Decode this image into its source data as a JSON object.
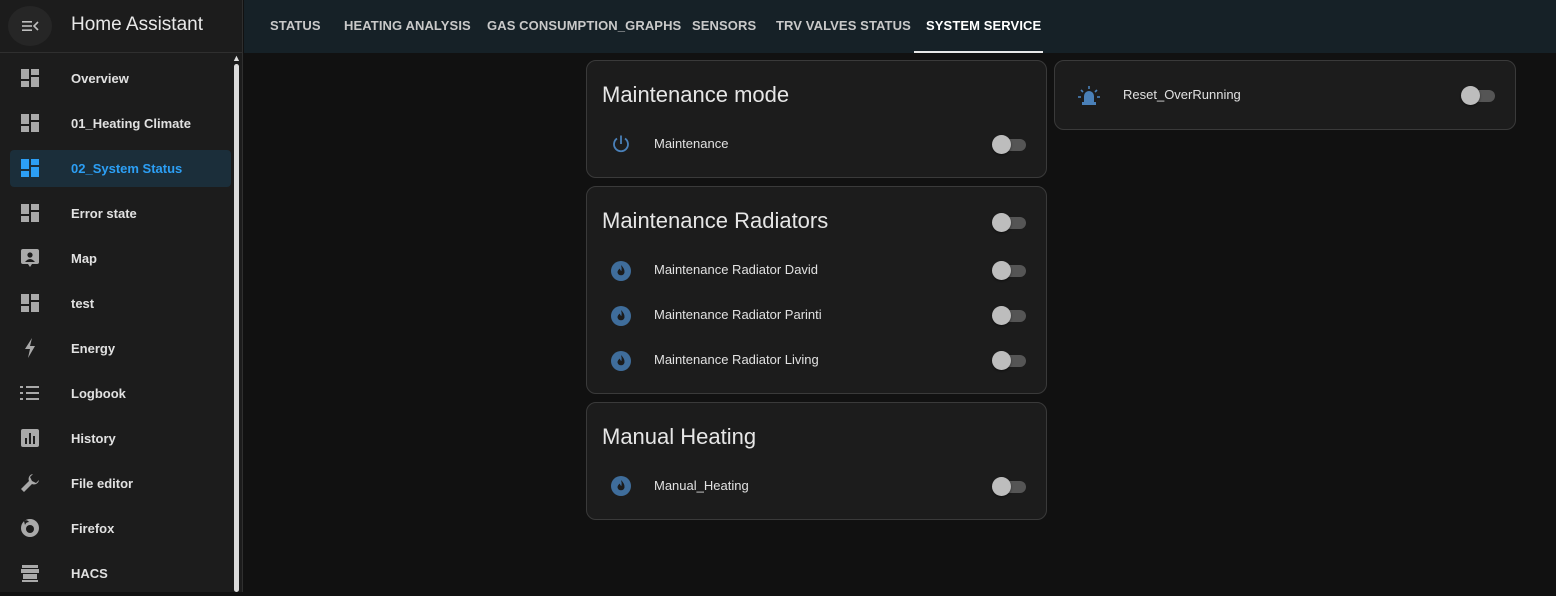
{
  "app": {
    "title": "Home Assistant"
  },
  "sidebar": {
    "items": [
      {
        "label": "Overview",
        "icon": "dashboard-icon"
      },
      {
        "label": "01_Heating Climate",
        "icon": "dashboard-icon"
      },
      {
        "label": "02_System Status",
        "icon": "dashboard-icon",
        "active": true
      },
      {
        "label": "Error state",
        "icon": "dashboard-icon"
      },
      {
        "label": "Map",
        "icon": "map-pin-icon"
      },
      {
        "label": "test",
        "icon": "dashboard-icon"
      },
      {
        "label": "Energy",
        "icon": "lightning-icon"
      },
      {
        "label": "Logbook",
        "icon": "list-icon"
      },
      {
        "label": "History",
        "icon": "chart-icon"
      },
      {
        "label": "File editor",
        "icon": "wrench-icon"
      },
      {
        "label": "Firefox",
        "icon": "firefox-icon"
      },
      {
        "label": "HACS",
        "icon": "hacs-icon"
      }
    ]
  },
  "tabs": [
    {
      "label": "STATUS"
    },
    {
      "label": "HEATING ANALYSIS"
    },
    {
      "label": "GAS CONSUMPTION_GRAPHS"
    },
    {
      "label": "SENSORS"
    },
    {
      "label": "TRV VALVES STATUS"
    },
    {
      "label": "SYSTEM SERVICE",
      "active": true
    }
  ],
  "cards": {
    "maintenance_mode": {
      "title": "Maintenance mode",
      "rows": [
        {
          "label": "Maintenance",
          "icon": "power-icon",
          "on": false
        }
      ]
    },
    "maintenance_radiators": {
      "title": "Maintenance Radiators",
      "header_toggle_on": false,
      "rows": [
        {
          "label": "Maintenance Radiator David",
          "icon": "fire-circle-icon",
          "on": false
        },
        {
          "label": "Maintenance Radiator Parinti",
          "icon": "fire-circle-icon",
          "on": false
        },
        {
          "label": "Maintenance Radiator Living",
          "icon": "fire-circle-icon",
          "on": false
        }
      ]
    },
    "manual_heating": {
      "title": "Manual Heating",
      "rows": [
        {
          "label": "Manual_Heating",
          "icon": "fire-circle-icon",
          "on": false
        }
      ]
    },
    "reset": {
      "rows": [
        {
          "label": "Reset_OverRunning",
          "icon": "alarm-light-icon",
          "on": false
        }
      ]
    }
  },
  "colors": {
    "accent": "#2c9ff5",
    "icon_blue": "#3f6d9b",
    "background": "#111111",
    "card": "#1c1c1c",
    "topbar": "#162127"
  }
}
